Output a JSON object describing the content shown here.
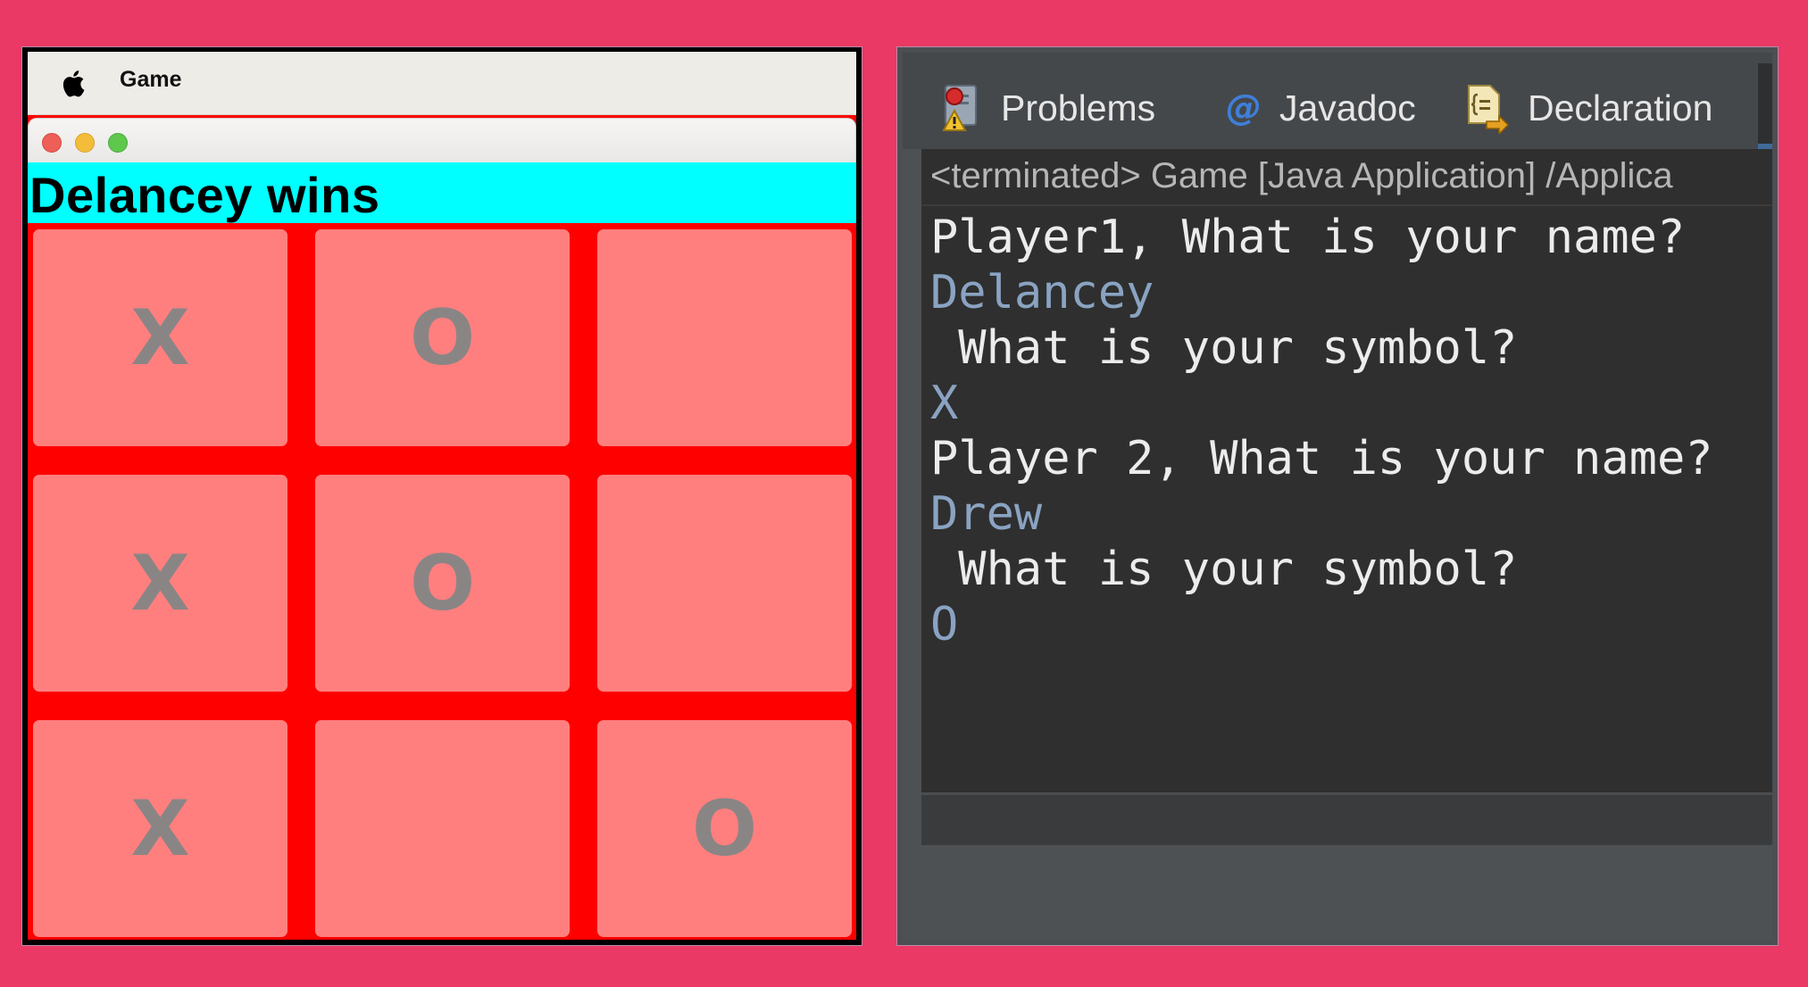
{
  "game_window": {
    "menu_app_name": "Game",
    "status_text": "Delancey wins",
    "board": [
      [
        "X",
        "O",
        ""
      ],
      [
        "X",
        "O",
        ""
      ],
      [
        "X",
        "",
        "O"
      ]
    ],
    "colors": {
      "board_background": "#ff0000",
      "cell_background": "#ff7f7f",
      "status_background": "#00ffff",
      "symbol_color": "#8a8585"
    }
  },
  "console_window": {
    "tabs": [
      {
        "label": "Problems",
        "icon": "problems-icon"
      },
      {
        "label": "Javadoc",
        "icon": "javadoc-at-icon"
      },
      {
        "label": "Declaration",
        "icon": "declaration-icon"
      }
    ],
    "header": "<terminated> Game [Java Application] /Applica",
    "lines": [
      {
        "text": "Player1, What is your name?",
        "kind": "output"
      },
      {
        "text": "Delancey",
        "kind": "input"
      },
      {
        "text": " What is your symbol?",
        "kind": "output"
      },
      {
        "text": "X",
        "kind": "input"
      },
      {
        "text": "Player 2, What is your name?",
        "kind": "output"
      },
      {
        "text": "Drew",
        "kind": "input"
      },
      {
        "text": " What is your symbol?",
        "kind": "output"
      },
      {
        "text": "O",
        "kind": "input"
      }
    ],
    "colors": {
      "output_text": "#ececec",
      "input_text": "#8aa3c2",
      "console_background": "#2f2f2f"
    }
  }
}
